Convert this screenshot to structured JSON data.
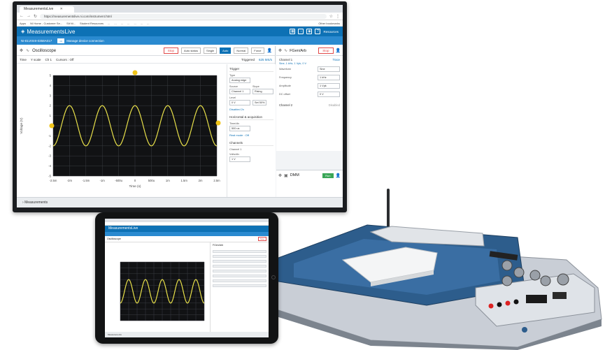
{
  "browser": {
    "tab_title": "MeasurementsLive",
    "url": "https://measurementslive.ni.com/instrument.html",
    "bookmarks": [
      "Apps",
      "NI Home - Customer Se...",
      "Sit Ni...",
      "Student Resources",
      "...",
      "...",
      "...",
      "...",
      "...",
      "...",
      "...",
      "Other bookmarks"
    ]
  },
  "app": {
    "title": "MeasurementsLive",
    "resources": "Resources",
    "device_id": "NI-ELVISIII-0358A017",
    "manage": "Manage device connection"
  },
  "oscilloscope": {
    "name": "Oscilloscope",
    "stop": "Stop",
    "acquisition": "Auto status",
    "modes": [
      "Single",
      "Auto",
      "Normal"
    ],
    "active_mode": "Auto",
    "force": "Force",
    "toolbar": {
      "time": "Time",
      "y_scale": "Y scale",
      "channel": "Ch 1",
      "cursors": "Cursors : Off"
    },
    "triggered": "Triggered",
    "rate": "625 MS/s",
    "x_ticks": [
      "-2.5m",
      "-2m",
      "-1.5m",
      "-1m",
      "-500u",
      "0",
      "500u",
      "1m",
      "1.5m",
      "2m",
      "2.5m"
    ],
    "y_ticks": [
      "5",
      "4",
      "3",
      "2",
      "1",
      "0",
      "-1",
      "-2",
      "-3",
      "-4",
      "-5"
    ],
    "xlabel": "Time (s)",
    "ylabel": "Voltage (V)",
    "trace_color": "#e8e04a",
    "trigger": {
      "section": "Trigger",
      "type_label": "Type",
      "type_value": "Analog edge",
      "source_label": "Source",
      "source_value": "Channel 1",
      "slope_label": "Slope",
      "slope_value": "Rising",
      "level_label": "Level",
      "level_value": "0 V",
      "set_50": "Set 50%",
      "disabled_link": "Disabled 2x",
      "horizontal": "Horizontal & acquisition",
      "time_per_div_label": "Time/div",
      "time_per_div": "500 us",
      "advanced_link": "Real mode : Off",
      "channels": "Channels",
      "channel1": "Channel 1",
      "volts_div_label": "Volts/div",
      "volts_div": "1 V"
    },
    "measurements": "Measurements"
  },
  "fgen": {
    "name": "FGen/Arb",
    "stop": "Stop",
    "channel1": "Channel 1",
    "channel1_status": "Trace",
    "channel1_sub": "Sine, 1 kHz, 1 Vpk, 0 V",
    "rows": [
      {
        "label": "Waveform",
        "value": "Sine"
      },
      {
        "label": "Frequency",
        "value": "1 kHz"
      },
      {
        "label": "Amplitude",
        "value": "1 Vpk"
      },
      {
        "label": "DC offset",
        "value": "0 V"
      }
    ],
    "channel2": "Channel 2",
    "channel2_status": "Disabled"
  },
  "dmm": {
    "name": "DMM",
    "run": "Run"
  },
  "tablet": {
    "title": "MeasurementsLive",
    "oscilloscope": "Oscilloscope",
    "stop": "Stop",
    "fgen": "FGen/Arb",
    "measurements": "Measurements"
  },
  "colors": {
    "brand_blue": "#0d71b5",
    "stop_red": "#e24a4a",
    "run_green": "#3aa657"
  }
}
